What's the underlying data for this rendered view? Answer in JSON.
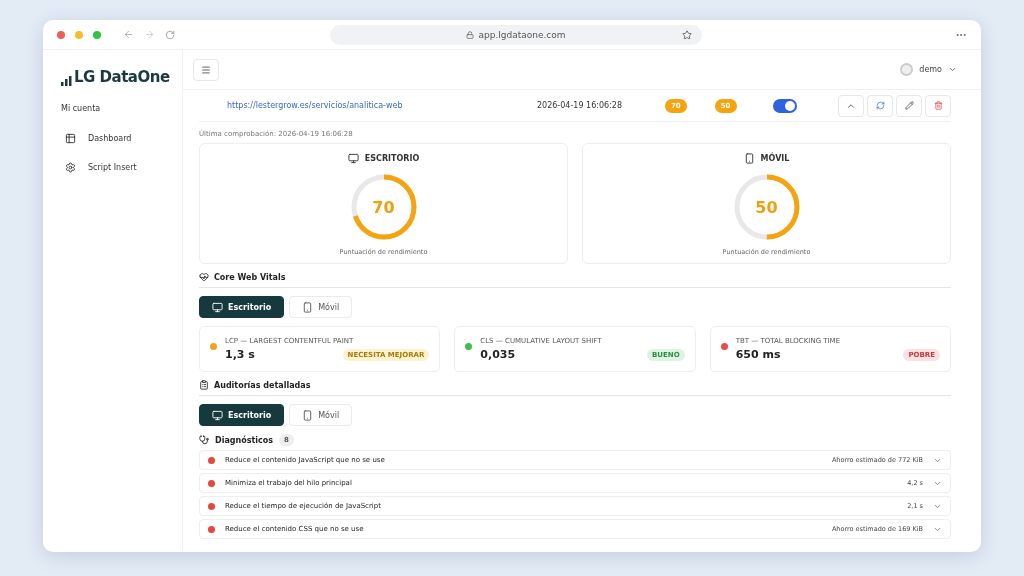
{
  "browser": {
    "url": "app.lgdataone.com"
  },
  "sidebar": {
    "logo": "LG DataOne",
    "heading": "Mi cuenta",
    "items": [
      {
        "label": "Dashboard",
        "kind": "table"
      },
      {
        "label": "Script Insert",
        "kind": "gear"
      }
    ]
  },
  "header": {
    "user": "demo"
  },
  "site_row": {
    "url": "https://lestergrow.es/servicios/analitica-web",
    "date": "2026-04-19 16:06:28",
    "scores": [
      "70",
      "50"
    ],
    "on": true
  },
  "last_check": "Última comprobación: 2026-04-19 16:06:28",
  "score_cards": [
    {
      "title": "ESCRITORIO",
      "kind": "desktop",
      "score": "70",
      "level": 0.7,
      "caption": "Puntuación de rendimiento"
    },
    {
      "title": "MÓVIL",
      "kind": "mobile",
      "score": "50",
      "level": 0.5,
      "caption": "Puntuación de rendimiento"
    }
  ],
  "vitals": {
    "title": "Core Web Vitals",
    "tabs": [
      {
        "label": "Escritorio",
        "kind": "desktop",
        "selected": true
      },
      {
        "label": "Móvil",
        "kind": "mobile",
        "selected": false
      }
    ],
    "metrics": [
      {
        "label": "LCP — LARGEST CONTENTFUL PAINT",
        "value": "1,3 s",
        "color": "#f0a31c",
        "rating": "NECESITA MEJORAR",
        "kind": "average"
      },
      {
        "label": "CLS — CUMULATIVE LAYOUT SHIFT",
        "value": "0,035",
        "color": "#3cc04a",
        "rating": "BUENO",
        "kind": "good"
      },
      {
        "label": "TBT — TOTAL BLOCKING TIME",
        "value": "650 ms",
        "color": "#ec4a45",
        "rating": "POBRE",
        "kind": "poor"
      }
    ]
  },
  "audits": {
    "title": "Auditorías detalladas",
    "tabs": [
      {
        "label": "Escritorio",
        "kind": "desktop",
        "selected": true
      },
      {
        "label": "Móvil",
        "kind": "mobile",
        "selected": false
      }
    ],
    "diagnostics": {
      "title": "Diagnósticos",
      "count": "8",
      "items": [
        {
          "label": "Reduce el contenido JavaScript que no se use",
          "value": "Ahorro estimado de 772 KiB",
          "color": "#e8453c"
        },
        {
          "label": "Minimiza el trabajo del hilo principal",
          "value": "4,2 s",
          "color": "#e8453c"
        },
        {
          "label": "Reduce el tiempo de ejecución de JavaScript",
          "value": "2,1 s",
          "color": "#e8453c"
        },
        {
          "label": "Reduce el contenido CSS que no se use",
          "value": "Ahorro estimado de 169 KiB",
          "color": "#e8453c"
        }
      ]
    }
  }
}
